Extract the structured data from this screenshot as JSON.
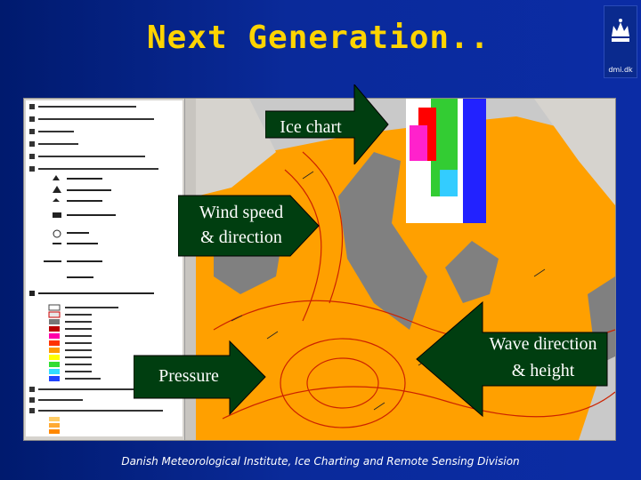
{
  "slide": {
    "title": "Next Generation..",
    "logo": {
      "text": "dmi.dk",
      "icon": "crown-icon"
    },
    "footer": "Danish Meteorological Institute, Ice Charting and Remote Sensing Division"
  },
  "callouts": {
    "ice_chart": "Ice chart",
    "wind": [
      "Wind speed",
      "& direction"
    ],
    "pressure": "Pressure",
    "wave": [
      "Wave direction",
      "& height"
    ]
  }
}
